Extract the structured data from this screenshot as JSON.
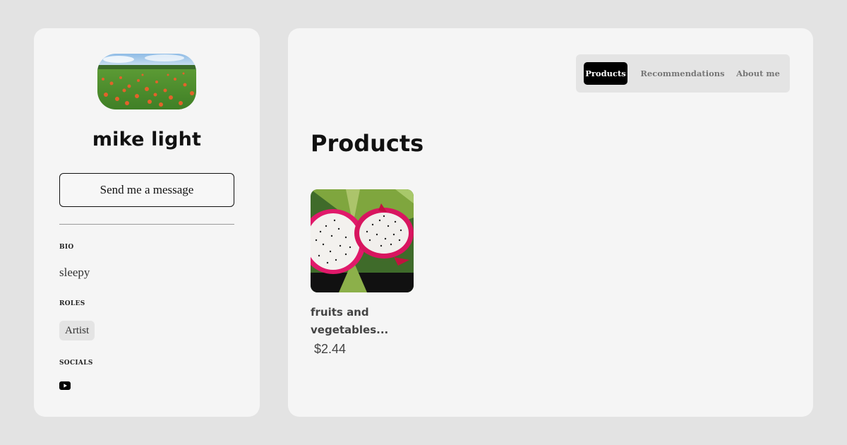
{
  "profile": {
    "name": "mike light",
    "avatar_icon": "landscape-flower-field-image",
    "message_button_label": "Send me a message",
    "bio_label": "BIO",
    "bio_text": "sleepy",
    "roles_label": "ROLES",
    "roles": [
      "Artist"
    ],
    "socials_label": "SOCIALS",
    "socials": [
      {
        "icon": "youtube-icon"
      }
    ]
  },
  "nav": {
    "tabs": [
      {
        "label": "Products",
        "active": true
      },
      {
        "label": "Recommendations",
        "active": false
      },
      {
        "label": "About me",
        "active": false
      }
    ]
  },
  "main": {
    "title": "Products",
    "products": [
      {
        "name": "fruits and vegetables...",
        "price": "$2.44",
        "image_icon": "dragon-fruit-image"
      }
    ]
  },
  "colors": {
    "page_background": "#e3e3e3",
    "card_background": "#f5f5f5",
    "active_tab": "#000000",
    "tabbar_background": "#e4e4e4"
  }
}
